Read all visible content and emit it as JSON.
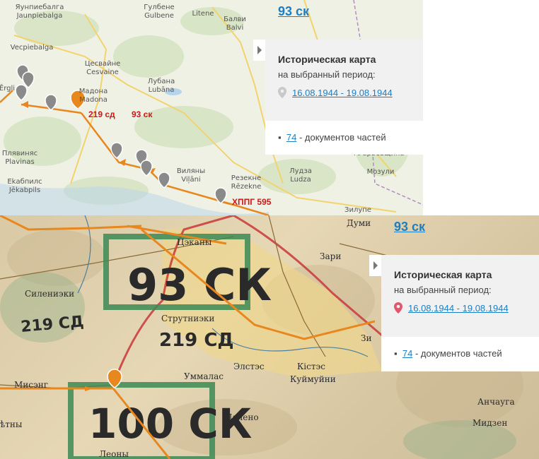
{
  "top_map": {
    "places": [
      "Яунпиебалга",
      "Jaunpiebalga",
      "Гулбене",
      "Gulbene",
      "Litene",
      "Балви",
      "Balvi",
      "Vecpiebalga",
      "Цесвайне",
      "Cesvaine",
      "Лубана",
      "Lubāna",
      "Мадона",
      "Madona",
      "Ērgli",
      "Плявиняс",
      "Plavinas",
      "Ekабпилс",
      "Jēkabpils",
      "Виляны",
      "Viļāni",
      "Резекне",
      "Rēzekne",
      "Лудза",
      "Ludza",
      "Агарьевщина",
      "Мозули",
      "Зилупе"
    ],
    "unit_labels": [
      "219 сд",
      "93 ск",
      "ХППГ 595"
    ]
  },
  "top_panel": {
    "title": "93 ск",
    "hist_title": "Историческая карта",
    "hist_sub": "на выбранный период:",
    "period": "16.08.1944 - 19.08.1944",
    "docs_count": "74",
    "docs_text": "- документов частей"
  },
  "bottom_map": {
    "places": [
      "Думи",
      "Цэканы",
      "Зари",
      "Силениэки",
      "Струтниэки",
      "Зи",
      "Кістэс",
      "Куймуйни",
      "Уммалас",
      "Мисэнг",
      "Элстэс",
      "Анчауга",
      "Мидзен",
      "Леоны",
      "Палено",
      "ѣтны"
    ],
    "stamps": [
      "93 СК",
      "219 СД",
      "219 СД",
      "100 СК"
    ]
  },
  "bottom_panel": {
    "title": "93 ск",
    "hist_title": "Историческая карта",
    "hist_sub": "на выбранный период:",
    "period": "16.08.1944 - 19.08.1944",
    "docs_count": "74",
    "docs_text": "- документов частей"
  }
}
